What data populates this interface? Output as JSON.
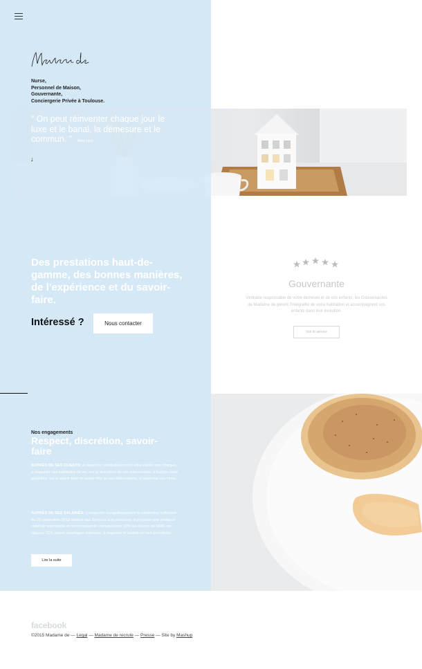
{
  "header": {
    "menu_icon": "hamburger-icon",
    "logo_text": "Madame de",
    "tagline": [
      "Nurse,",
      "Personnel de Maison,",
      "Gouvernante,",
      "Conciergerie Privée à Toulouse."
    ]
  },
  "hero": {
    "quote": "“ On peut réinventer chaque jour le luxe et le banal, la démesure et le commun. ”",
    "author": "Mary Lacy",
    "arrow": "↓"
  },
  "prestations": {
    "heading": "Des prestations haut-de-gamme, des bonnes manières, de l'expérience et du savoir-faire.",
    "interested": "Intéressé ?",
    "contact_button": "Nous contacter"
  },
  "service": {
    "stars": 5,
    "title": "Gouvernante",
    "description": "Véritable responsable de votre demeure et de vos enfants, les Gouvernantes de Madame de gèrent l'intégralité de votre habitation et accompagnent vos enfants dans leur évolution.",
    "button": "Voir le service"
  },
  "engagements": {
    "kicker": "Nos engagements",
    "heading": "Respect, discrétion, savoir-faire",
    "clients_lead": "AUPRÈS DE SES CLIENTS:",
    "clients_text": " à respecter scrupuleusement votre cahier des charges, à respecter vos habitudes de vie, sur la discrétion de ses intervenants, à faciliter votre quotidien, sur le savoir-faire et savoir-être de ses intervenants, à respecter vos choix…",
    "employees_lead": "AUPRÈS DE SES SALARIÉS:",
    "employees_text": " à respecter scrupuleusement la convention collective du 20 septembre 2012 relative aux Services à la personne, à proposer une politique salariale valorisante et reconnaissante: rémunération 10% au dessus du SMIC en vigueur, CDI, autres avantages salariaux, à respecter le salarié en tant qu'individu.",
    "read_more": "Lire la suite"
  },
  "footer": {
    "social": "facebook",
    "copyright": "©2015 Madame de — ",
    "legal": "Legal",
    "sep1": " — ",
    "recruit": "Madame de recrute",
    "sep2": " — ",
    "press": "Presse",
    "sep3": " — Site by ",
    "agency": "Mashup"
  },
  "colors": {
    "accent_blue": "#d4e8f6",
    "dark": "#111111",
    "muted_grey": "#c3c9cd"
  }
}
